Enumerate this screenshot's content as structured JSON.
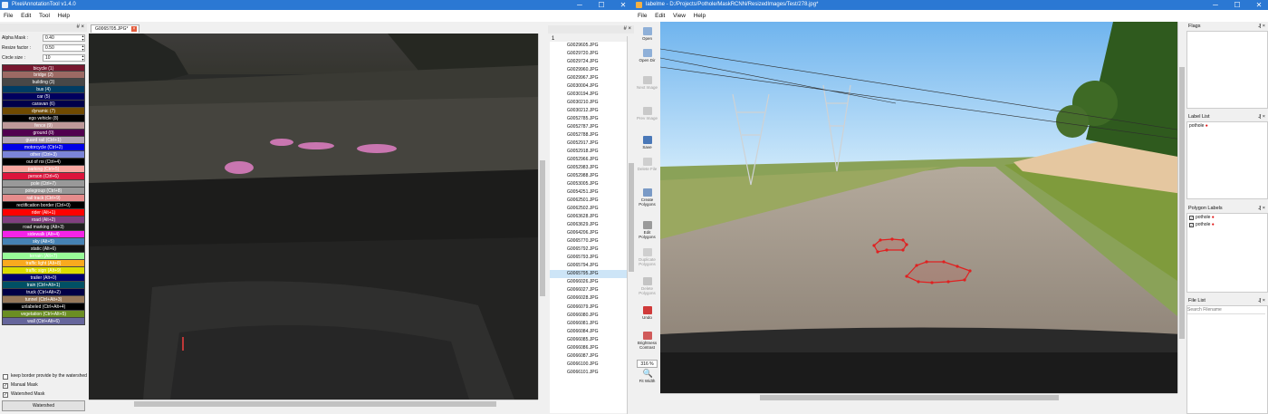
{
  "win1": {
    "title": "PixelAnnotationTool v1.4.0",
    "menu": [
      "File",
      "Edit",
      "Tool",
      "Help"
    ],
    "dock_pin": "# ×",
    "params": [
      {
        "label": "Alpha Mask :",
        "value": "0.40"
      },
      {
        "label": "Resize factor :",
        "value": "0.50"
      },
      {
        "label": "Circle size :",
        "value": "10"
      }
    ],
    "labels": [
      {
        "text": "bicycle (1)",
        "color": "#77172f"
      },
      {
        "text": "bridge (2)",
        "color": "#9c6a64"
      },
      {
        "text": "building (3)",
        "color": "#474747"
      },
      {
        "text": "bus (4)",
        "color": "#003c63"
      },
      {
        "text": "car (5)",
        "color": "#00005e"
      },
      {
        "text": "caravan (6)",
        "color": "#00004a"
      },
      {
        "text": "dynamic (7)",
        "color": "#6f4a00"
      },
      {
        "text": "ego vehicle (8)",
        "color": "#000000"
      },
      {
        "text": "fence (9)",
        "color": "#be9999"
      },
      {
        "text": "ground (0)",
        "color": "#51004f"
      },
      {
        "text": "guard rail (Ctrl+1)",
        "color": "#b3a5b4"
      },
      {
        "text": "motorcycle (Ctrl+2)",
        "color": "#0000e6"
      },
      {
        "text": "other (Ctrl+3)",
        "color": "#7b84d8"
      },
      {
        "text": "out of roi (Ctrl+4)",
        "color": "#000000"
      },
      {
        "text": "parking (Ctrl+5)",
        "color": "#f9a7a0"
      },
      {
        "text": "person (Ctrl+6)",
        "color": "#dc143c"
      },
      {
        "text": "pole (Ctrl+7)",
        "color": "#999999"
      },
      {
        "text": "polegroup (Ctrl+8)",
        "color": "#989898"
      },
      {
        "text": "rail track (Ctrl+9)",
        "color": "#e68c8c"
      },
      {
        "text": "rectification border (Ctrl+0)",
        "color": "#000000"
      },
      {
        "text": "rider (Alt+1)",
        "color": "#ff0000"
      },
      {
        "text": "road (Alt+2)",
        "color": "#80407f"
      },
      {
        "text": "road marking (Alt+3)",
        "color": "#202020"
      },
      {
        "text": "sidewalk (Alt+4)",
        "color": "#f423e8"
      },
      {
        "text": "sky (Alt+5)",
        "color": "#4682b4"
      },
      {
        "text": "static (Alt+6)",
        "color": "#141414"
      },
      {
        "text": "terrain (Alt+7)",
        "color": "#98fb98"
      },
      {
        "text": "traffic light (Alt+8)",
        "color": "#faaa1e"
      },
      {
        "text": "traffic sign (Alt+9)",
        "color": "#dcdc00"
      },
      {
        "text": "trailer (Alt+0)",
        "color": "#00006e"
      },
      {
        "text": "train (Ctrl+Alt+1)",
        "color": "#005064"
      },
      {
        "text": "truck (Ctrl+Alt+2)",
        "color": "#000046"
      },
      {
        "text": "tunnel (Ctrl+Alt+3)",
        "color": "#96785a"
      },
      {
        "text": "unlabeled (Ctrl+Alt+4)",
        "color": "#000000"
      },
      {
        "text": "vegetation (Ctrl+Alt+5)",
        "color": "#6b8e23"
      },
      {
        "text": "wall (Ctrl+Alt+6)",
        "color": "#66669c"
      }
    ],
    "checks": [
      {
        "text": "keep border provide by the watershed",
        "checked": false
      },
      {
        "text": "Manual Mask",
        "checked": true
      },
      {
        "text": "Watershed Mask",
        "checked": true
      }
    ],
    "watershed_btn": "Watershed",
    "tab_label": "G0065705.JPG*",
    "list_header": "1",
    "files": [
      "G0029605.JPG",
      "G0029720.JPG",
      "G0029724.JPG",
      "G0029960.JPG",
      "G0029967.JPG",
      "G0030004.JPG",
      "G0030194.JPG",
      "G0030210.JPG",
      "G0030212.JPG",
      "G0052785.JPG",
      "G0052787.JPG",
      "G0052788.JPG",
      "G0052917.JPG",
      "G0052918.JPG",
      "G0052966.JPG",
      "G0052983.JPG",
      "G0052988.JPG",
      "G0053005.JPG",
      "G0054251.JPG",
      "G0062501.JPG",
      "G0062502.JPG",
      "G0063628.JPG",
      "G0063629.JPG",
      "G0064206.JPG",
      "G0065770.JPG",
      "G0065792.JPG",
      "G0065793.JPG",
      "G0065794.JPG",
      "G0065795.JPG",
      "G0066026.JPG",
      "G0066027.JPG",
      "G0066028.JPG",
      "G0066079.JPG",
      "G0066080.JPG",
      "G0066081.JPG",
      "G0066084.JPG",
      "G0066085.JPG",
      "G0066086.JPG",
      "G0066087.JPG",
      "G0066100.JPG",
      "G0066101.JPG"
    ],
    "selected_index": 28
  },
  "win2": {
    "title": "labelme - D:/Projects/Pothole/MaskRCNN/ResizedImages/Test/278.jpg*",
    "menu": [
      "File",
      "Edit",
      "View",
      "Help"
    ],
    "tools": [
      {
        "label": "Open",
        "icon": "open-folder-icon",
        "disabled": false
      },
      {
        "label": "Open Dir",
        "icon": "open-dir-icon",
        "disabled": false
      },
      {
        "label": "Next Image",
        "icon": "arrow-right-icon",
        "disabled": true
      },
      {
        "label": "Prev Image",
        "icon": "arrow-left-icon",
        "disabled": true
      },
      {
        "label": "Save",
        "icon": "save-icon",
        "disabled": false
      },
      {
        "label": "Delete File",
        "icon": "delete-file-icon",
        "disabled": true
      },
      {
        "label": "Create Polygons",
        "icon": "create-polygon-icon",
        "disabled": false
      },
      {
        "label": "Edit Polygons",
        "icon": "edit-polygon-icon",
        "disabled": false
      },
      {
        "label": "Duplicate Polygons",
        "icon": "duplicate-icon",
        "disabled": true
      },
      {
        "label": "Delete Polygons",
        "icon": "delete-polygon-icon",
        "disabled": true
      },
      {
        "label": "Undo",
        "icon": "undo-icon",
        "disabled": false
      },
      {
        "label": "Brightness Contrast",
        "icon": "brightness-icon",
        "disabled": false
      }
    ],
    "zoom": "316 %",
    "fit_width": "Fit Width",
    "panels": {
      "flags": "Flags",
      "label_list": "Label List",
      "polygon_labels": "Polygon Labels",
      "file_list": "File List",
      "search_placeholder": "Search Filename",
      "label_items": [
        "pothole"
      ],
      "polygon_items": [
        "pothole",
        "pothole"
      ]
    },
    "dock_pin": "₰ ×"
  }
}
